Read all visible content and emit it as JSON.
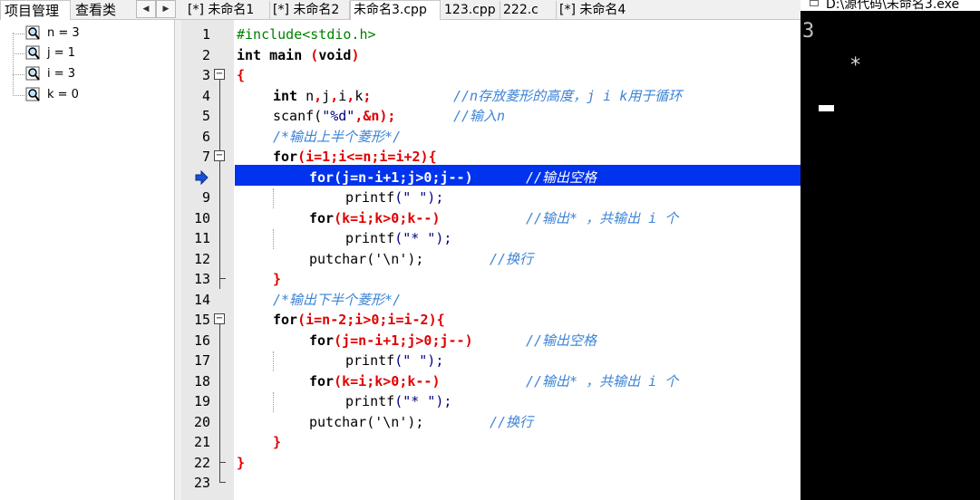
{
  "left_tabs": [
    "项目管理",
    "查看类"
  ],
  "watch_items": [
    "n = 3",
    "j = 1",
    "i = 3",
    "k = 0"
  ],
  "file_tabs": [
    "[*] 未命名1",
    "[*] 未命名2",
    "未命名3.cpp",
    "123.cpp",
    "222.c",
    "[*] 未命名4"
  ],
  "active_file_tab": "未命名3.cpp",
  "line_numbers": [
    "1",
    "2",
    "3",
    "4",
    "5",
    "6",
    "7",
    "8",
    "9",
    "10",
    "11",
    "12",
    "13",
    "14",
    "15",
    "16",
    "17",
    "18",
    "19",
    "20",
    "21",
    "22",
    "23"
  ],
  "current_line": "8",
  "code": {
    "l1": "#include<stdio.h>",
    "l2_kw": "int",
    "l2_rest": " main ",
    "l2_p1": "(",
    "l2_void": "void",
    "l2_p2": ")",
    "brace_open": "{",
    "brace_close": "}",
    "l4_kw": "int",
    "l4_rest": " n",
    "l4_rest2": ",j,i,k",
    "l4_semi": ";",
    "l4_cm": "//n存放菱形的高度，j i k用于循环",
    "l5_a": "scanf(",
    "l5_str": "\"%d\"",
    "l5_b": ",&n);",
    "l5_cm": "//输入n",
    "l6_cm": "/*输出上半个菱形*/",
    "l7_kw": "for",
    "l7_rest": "(i=1;i<=n;i=i+2){",
    "l8_kw": "for",
    "l8_rest": "(j=n-i+1;j>0;j--)",
    "l8_cm": "//输出空格",
    "printf": "printf",
    "str_space": "(\" \");",
    "str_star": "(\"* \");",
    "l10_kw": "for",
    "l10_rest": "(k=i;k>0;k--)",
    "l10_cm": "//输出* ，共输出 i 个",
    "putchar": "putchar('\\n');",
    "l12_cm": "//换行",
    "l14_cm": "/*输出下半个菱形*/",
    "l15_kw": "for",
    "l15_rest": "(i=n-2;i>0;i=i-2){",
    "l16_kw": "for",
    "l16_rest": "(j=n-i+1;j>0;j--)",
    "l16_cm": "//输出空格",
    "l18_kw": "for",
    "l18_rest": "(k=i;k>0;k--)",
    "l18_cm": "//输出* ，共输出 i 个",
    "l20_cm": "//换行"
  },
  "console": {
    "title": "D:\\源代码\\未命名3.exe",
    "line1": "3",
    "line2": "*"
  }
}
